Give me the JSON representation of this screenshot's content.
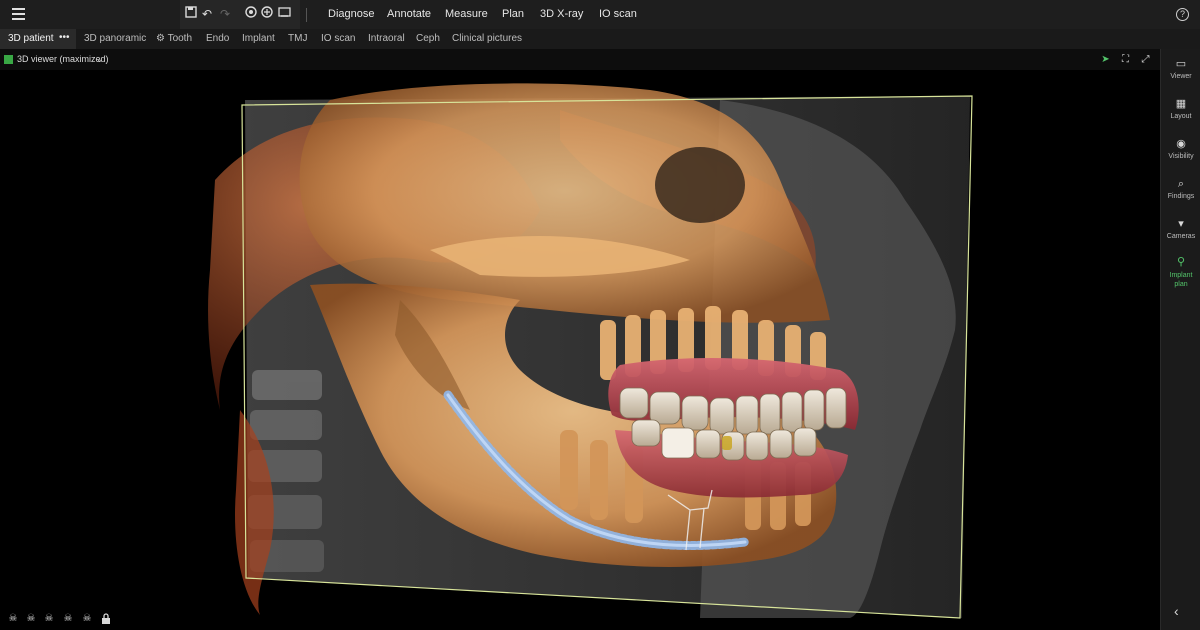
{
  "toolbar": {
    "icons": [
      "save-icon",
      "undo-icon",
      "redo-icon",
      "tooth-icon",
      "tooth-settings-icon",
      "screen-icon"
    ],
    "menu": [
      "Diagnose",
      "Annotate",
      "Measure",
      "Plan",
      "3D X-ray",
      "IO scan"
    ],
    "help": "?"
  },
  "tabs": {
    "active": "3D patient",
    "more": "•••",
    "items": [
      "3D panoramic",
      "⚙ Tooth",
      "Endo",
      "Implant",
      "TMJ",
      "IO scan",
      "Intraoral",
      "Ceph",
      "Clinical pictures"
    ]
  },
  "viewer": {
    "title": "3D viewer (maximized)",
    "cube_color": "#39a845"
  },
  "sidebar": {
    "items": [
      {
        "label": "Viewer",
        "icon": "viewer-icon"
      },
      {
        "label": "Layout",
        "icon": "layout-icon"
      },
      {
        "label": "Visibility",
        "icon": "eye-icon"
      },
      {
        "label": "Findings",
        "icon": "findings-icon"
      },
      {
        "label": "Cameras",
        "icon": "camera-icon"
      },
      {
        "label": "Implant plan",
        "icon": "implant-icon"
      }
    ],
    "active_color": "#53c46a"
  },
  "colors": {
    "bone": "#e3a866",
    "soft_tissue": "#b2502a",
    "nerve": "#8fb8ec",
    "gum": "#b6404a",
    "frame": "#d8e49a"
  }
}
